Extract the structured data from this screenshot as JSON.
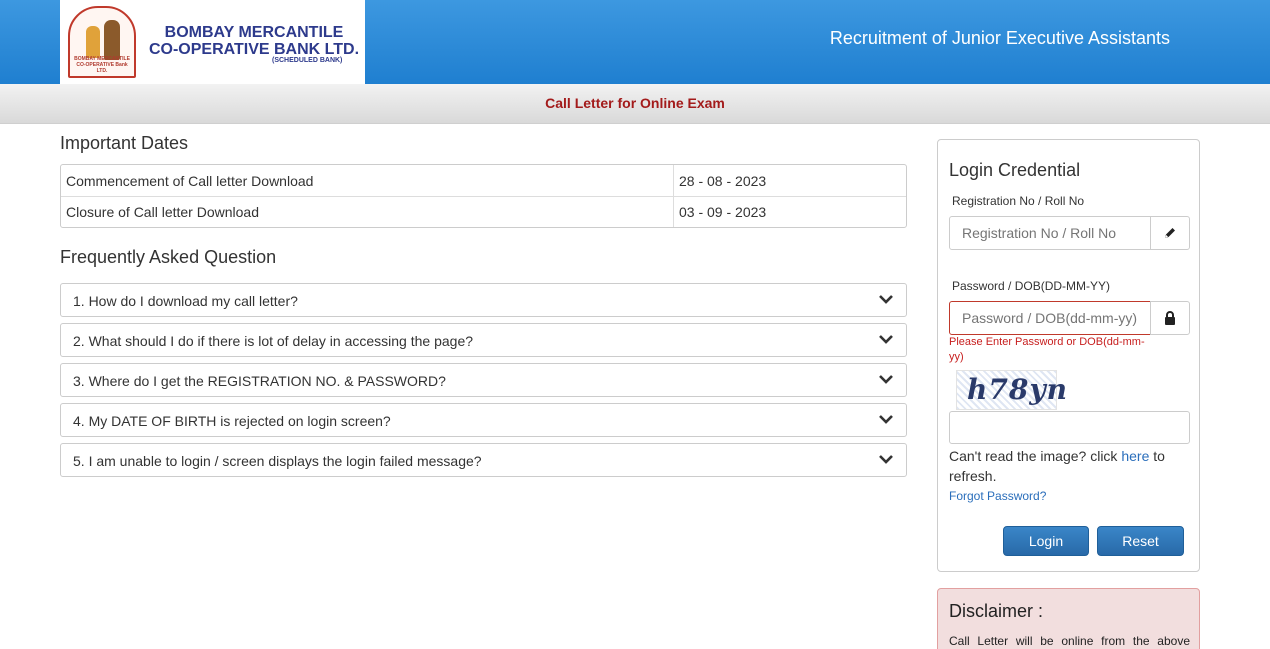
{
  "header": {
    "logo": {
      "bank_name_line1": "BOMBAY MERCANTILE",
      "bank_name_line2": "CO-OPERATIVE BANK LTD.",
      "bank_subtitle": "(SCHEDULED BANK)",
      "emblem_caption": "BOMBAY MERCANTILE CO-OPERATIVE Bank LTD."
    },
    "title": "Recruitment of Junior Executive Assistants",
    "colors": {
      "bar": "#2a8ad8",
      "title_text": "#ffffff"
    }
  },
  "subheader": {
    "title": "Call Letter for Online Exam",
    "color": "#a31b1b"
  },
  "important_dates": {
    "title": "Important Dates",
    "rows": [
      {
        "label": "Commencement of Call letter Download",
        "value": "28 - 08 - 2023"
      },
      {
        "label": "Closure of Call letter Download",
        "value": "03 - 09 - 2023"
      }
    ]
  },
  "faq": {
    "title": "Frequently Asked Question",
    "items": [
      {
        "question": "1. How do I download my call letter?",
        "icon": "chevron-down-icon"
      },
      {
        "question": "2. What should I do if there is lot of delay in accessing the page?",
        "icon": "chevron-down-icon"
      },
      {
        "question": "3. Where do I get the REGISTRATION NO. & PASSWORD?",
        "icon": "chevron-down-icon"
      },
      {
        "question": "4. My DATE OF BIRTH is rejected on login screen?",
        "icon": "chevron-down-icon"
      },
      {
        "question": "5. I am unable to login / screen displays the login failed message?",
        "icon": "chevron-down-icon"
      }
    ]
  },
  "login": {
    "title": "Login Credential",
    "registration": {
      "label": "Registration No / Roll No",
      "placeholder": "Registration No / Roll No",
      "value": "",
      "icon": "pencil-icon"
    },
    "password": {
      "label": "Password / DOB(DD-MM-YY)",
      "placeholder": "Password / DOB(dd-mm-yy)",
      "value": "",
      "icon": "lock-icon",
      "error": "Please Enter Password or DOB(dd-mm-yy)",
      "error_color": "#c71e1e"
    },
    "captcha": {
      "text": "h78yn",
      "input_value": "",
      "refresh_prefix": "Can't read the image? click",
      "refresh_link": "here",
      "refresh_suffix": "to refresh."
    },
    "forgot_password": "Forgot Password?",
    "login_button": "Login",
    "reset_button": "Reset",
    "button_color": "#2a6eb0"
  },
  "disclaimer": {
    "title": "Disclaimer :",
    "text": "Call Letter will be online from the above"
  }
}
